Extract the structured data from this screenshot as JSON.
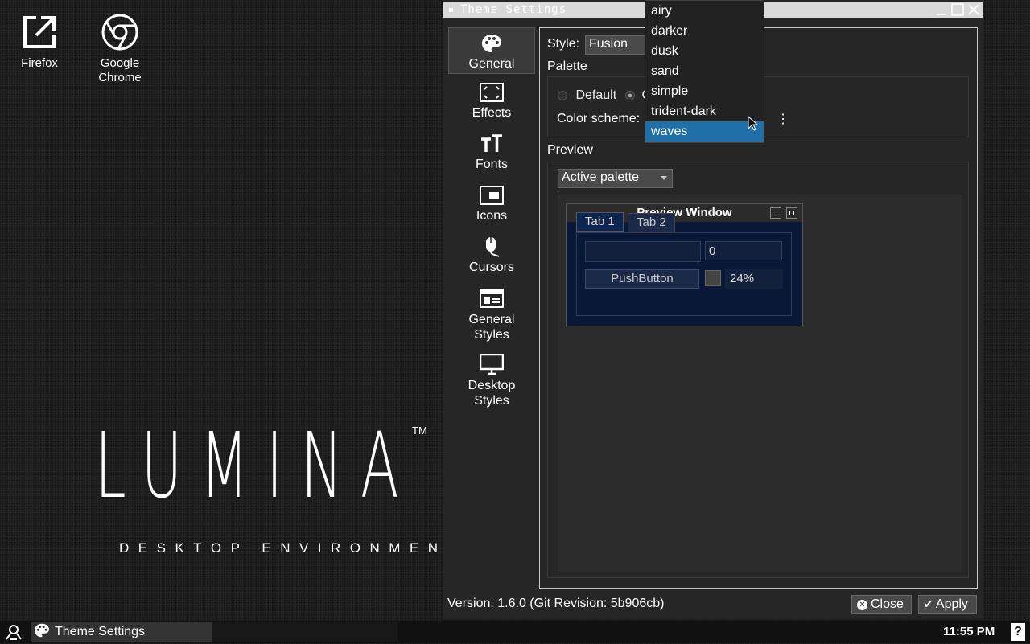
{
  "desktop": {
    "icons": [
      {
        "label": "Firefox",
        "icon": "external-link-icon"
      },
      {
        "label": "Google Chrome",
        "icon": "chrome-icon"
      }
    ],
    "logo": {
      "text": "LUMINA",
      "tm": "TM",
      "subtitle": "DESKTOP ENVIRONMENT"
    }
  },
  "window": {
    "title": "Theme Settings",
    "sidebar": [
      {
        "label": "General",
        "icon": "palette-icon",
        "active": true
      },
      {
        "label": "Effects",
        "icon": "effects-icon"
      },
      {
        "label": "Fonts",
        "icon": "fonts-icon"
      },
      {
        "label": "Icons",
        "icon": "icons-icon"
      },
      {
        "label": "Cursors",
        "icon": "mouse-icon"
      },
      {
        "label": "General Styles",
        "icon": "window-styles-icon"
      },
      {
        "label": "Desktop Styles",
        "icon": "monitor-icon"
      }
    ],
    "style_label": "Style:",
    "style_value": "Fusion",
    "palette_label": "Palette",
    "radio_default": "Default",
    "radio_custom": "C",
    "color_scheme_label": "Color scheme:",
    "preview_label": "Preview",
    "preview_select": "Active palette",
    "preview_window": {
      "title": "Preview Window",
      "tabs": [
        "Tab 1",
        "Tab 2"
      ],
      "spin_value": "0",
      "push_button": "PushButton",
      "progress": "24%"
    },
    "version": "Version: 1.6.0 (Git Revision: 5b906cb)",
    "close_label": "Close",
    "apply_label": "Apply"
  },
  "dropdown": {
    "options": [
      "airy",
      "darker",
      "dusk",
      "sand",
      "simple",
      "trident-dark",
      "waves"
    ],
    "selected": "waves"
  },
  "taskbar": {
    "task_label": "Theme Settings",
    "clock": "11:55 PM"
  },
  "colors": {
    "selection": "#1f6fa8",
    "preview_bg": "#0a1838"
  }
}
